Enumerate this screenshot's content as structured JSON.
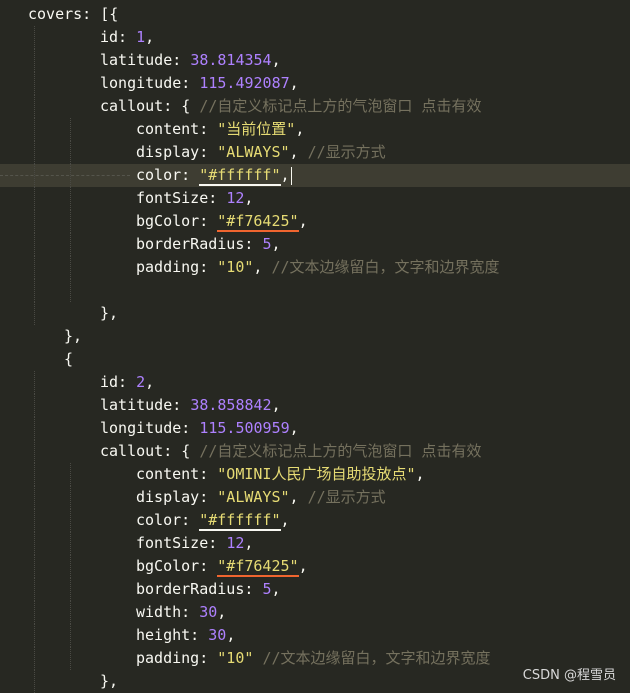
{
  "editor": {
    "lines": [
      {
        "indent": 0,
        "tokens": [
          [
            "k",
            "covers: [{"
          ]
        ]
      },
      {
        "indent": 2,
        "tokens": [
          [
            "k",
            "id: "
          ],
          [
            "num",
            "1"
          ],
          [
            "pn",
            ","
          ]
        ]
      },
      {
        "indent": 2,
        "tokens": [
          [
            "k",
            "latitude: "
          ],
          [
            "num",
            "38.814354"
          ],
          [
            "pn",
            ","
          ]
        ]
      },
      {
        "indent": 2,
        "tokens": [
          [
            "k",
            "longitude: "
          ],
          [
            "num",
            "115.492087"
          ],
          [
            "pn",
            ","
          ]
        ]
      },
      {
        "indent": 2,
        "tokens": [
          [
            "k",
            "callout: { "
          ],
          [
            "cmt",
            "//自定义标记点上方的气泡窗口 点击有效"
          ]
        ]
      },
      {
        "indent": 3,
        "tokens": [
          [
            "k",
            "content: "
          ],
          [
            "str",
            "\"当前位置\""
          ],
          [
            "pn",
            ","
          ]
        ]
      },
      {
        "indent": 3,
        "tokens": [
          [
            "k",
            "display: "
          ],
          [
            "str",
            "\"ALWAYS\""
          ],
          [
            "pn",
            ", "
          ],
          [
            "cmt",
            "//显示方式"
          ]
        ]
      },
      {
        "indent": 3,
        "current": true,
        "tokens": [
          [
            "k",
            "color: "
          ],
          [
            "str u-white",
            "\"#ffffff\""
          ],
          [
            "pn",
            ","
          ],
          [
            "caret",
            ""
          ]
        ]
      },
      {
        "indent": 3,
        "tokens": [
          [
            "k",
            "fontSize: "
          ],
          [
            "num",
            "12"
          ],
          [
            "pn",
            ","
          ]
        ]
      },
      {
        "indent": 3,
        "tokens": [
          [
            "k",
            "bgColor: "
          ],
          [
            "str u-orange",
            "\"#f76425\""
          ],
          [
            "pn",
            ","
          ]
        ]
      },
      {
        "indent": 3,
        "tokens": [
          [
            "k",
            "borderRadius: "
          ],
          [
            "num",
            "5"
          ],
          [
            "pn",
            ","
          ]
        ]
      },
      {
        "indent": 3,
        "tokens": [
          [
            "k",
            "padding: "
          ],
          [
            "str",
            "\"10\""
          ],
          [
            "pn",
            ", "
          ],
          [
            "cmt",
            "//文本边缘留白，文字和边界宽度"
          ]
        ]
      },
      {
        "indent": 3,
        "tokens": []
      },
      {
        "indent": 2,
        "tokens": [
          [
            "k",
            "},"
          ]
        ]
      },
      {
        "indent": 1,
        "tokens": [
          [
            "k",
            "},"
          ]
        ]
      },
      {
        "indent": 1,
        "tokens": [
          [
            "k",
            "{"
          ]
        ]
      },
      {
        "indent": 2,
        "tokens": [
          [
            "k",
            "id: "
          ],
          [
            "num",
            "2"
          ],
          [
            "pn",
            ","
          ]
        ]
      },
      {
        "indent": 2,
        "tokens": [
          [
            "k",
            "latitude: "
          ],
          [
            "num",
            "38.858842"
          ],
          [
            "pn",
            ","
          ]
        ]
      },
      {
        "indent": 2,
        "tokens": [
          [
            "k",
            "longitude: "
          ],
          [
            "num",
            "115.500959"
          ],
          [
            "pn",
            ","
          ]
        ]
      },
      {
        "indent": 2,
        "tokens": [
          [
            "k",
            "callout: { "
          ],
          [
            "cmt",
            "//自定义标记点上方的气泡窗口 点击有效"
          ]
        ]
      },
      {
        "indent": 3,
        "tokens": [
          [
            "k",
            "content: "
          ],
          [
            "str",
            "\"OMINI人民广场自助投放点\""
          ],
          [
            "pn",
            ","
          ]
        ]
      },
      {
        "indent": 3,
        "tokens": [
          [
            "k",
            "display: "
          ],
          [
            "str",
            "\"ALWAYS\""
          ],
          [
            "pn",
            ", "
          ],
          [
            "cmt",
            "//显示方式"
          ]
        ]
      },
      {
        "indent": 3,
        "tokens": [
          [
            "k",
            "color: "
          ],
          [
            "str u-white",
            "\"#ffffff\""
          ],
          [
            "pn",
            ","
          ]
        ]
      },
      {
        "indent": 3,
        "tokens": [
          [
            "k",
            "fontSize: "
          ],
          [
            "num",
            "12"
          ],
          [
            "pn",
            ","
          ]
        ]
      },
      {
        "indent": 3,
        "tokens": [
          [
            "k",
            "bgColor: "
          ],
          [
            "str u-orange",
            "\"#f76425\""
          ],
          [
            "pn",
            ","
          ]
        ]
      },
      {
        "indent": 3,
        "tokens": [
          [
            "k",
            "borderRadius: "
          ],
          [
            "num",
            "5"
          ],
          [
            "pn",
            ","
          ]
        ]
      },
      {
        "indent": 3,
        "tokens": [
          [
            "k",
            "width: "
          ],
          [
            "num",
            "30"
          ],
          [
            "pn",
            ","
          ]
        ]
      },
      {
        "indent": 3,
        "tokens": [
          [
            "k",
            "height: "
          ],
          [
            "num",
            "30"
          ],
          [
            "pn",
            ","
          ]
        ]
      },
      {
        "indent": 3,
        "tokens": [
          [
            "k",
            "padding: "
          ],
          [
            "str",
            "\"10\""
          ],
          [
            "pn",
            " "
          ],
          [
            "cmt",
            "//文本边缘留白，文字和边界宽度"
          ]
        ]
      },
      {
        "indent": 2,
        "tokens": [
          [
            "k",
            "},"
          ]
        ]
      }
    ]
  },
  "watermark": "CSDN @程雪员",
  "colors": {
    "background": "#272822",
    "current_line": "#3e3d32",
    "text": "#f8f8f2",
    "number": "#ae81ff",
    "string": "#e6db74",
    "comment": "#75715e",
    "underline_orange": "#f0652f"
  }
}
